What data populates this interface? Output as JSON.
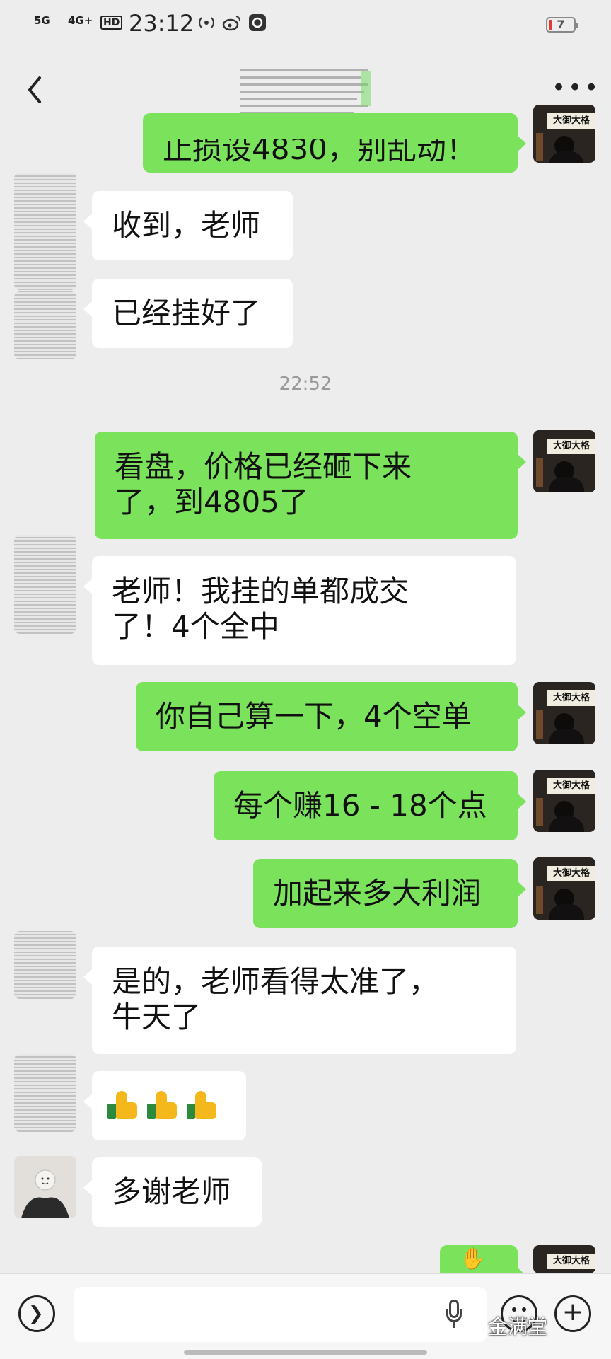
{
  "status_bar": {
    "signal1": "5G",
    "signal2": "4G+",
    "hd": "HD",
    "time": "23:12",
    "battery": "7"
  },
  "timestamp": "22:52",
  "messages": [
    {
      "side": "out",
      "text": "止损设4830，别乱动！"
    },
    {
      "side": "in",
      "text": "收到，老师"
    },
    {
      "side": "in",
      "text": "已经挂好了"
    },
    {
      "side": "out",
      "text": "看盘，价格已经砸下来了，到4805了"
    },
    {
      "side": "in",
      "text": "老师！我挂的单都成交了！4个全中"
    },
    {
      "side": "out",
      "text": "你自己算一下，4个空单"
    },
    {
      "side": "out",
      "text": "每个赚16 - 18个点"
    },
    {
      "side": "out",
      "text": "加起来多大利润"
    },
    {
      "side": "in",
      "text": "是的，老师看得太准了，牛天了"
    },
    {
      "side": "in",
      "emoji": "thumbs-up x3"
    },
    {
      "side": "in",
      "text": "多谢老师"
    }
  ],
  "watermark": "金满堂",
  "avatar_sign": "大御大格",
  "colors": {
    "outgoing_bubble": "#7be25c",
    "incoming_bubble": "#ffffff",
    "background": "#ededed"
  }
}
